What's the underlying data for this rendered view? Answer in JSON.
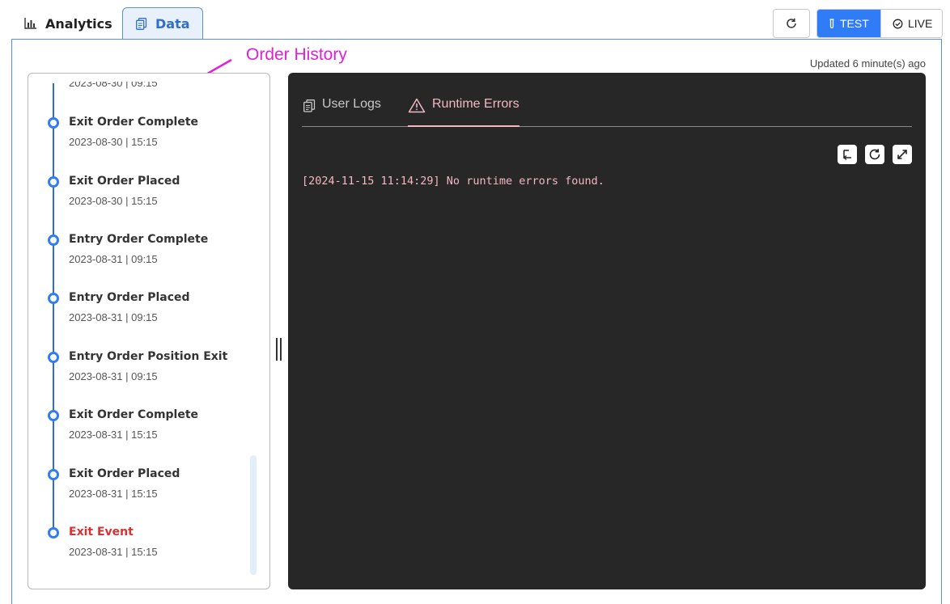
{
  "tabs": {
    "analytics_label": "Analytics",
    "data_label": "Data"
  },
  "mode": {
    "test_label": "TEST",
    "live_label": "LIVE",
    "selected": "TEST"
  },
  "annotation": {
    "text": "Order History",
    "color": "#e11fd8"
  },
  "status": {
    "updated_text": "Updated 6 minute(s) ago"
  },
  "timeline": {
    "cut_off_time": "2023-08-30 | 09:15",
    "items": [
      {
        "title": "Exit Order Complete",
        "time": "2023-08-30 | 15:15"
      },
      {
        "title": "Exit Order Placed",
        "time": "2023-08-30 | 15:15"
      },
      {
        "title": "Entry Order Complete",
        "time": "2023-08-31 | 09:15"
      },
      {
        "title": "Entry Order Placed",
        "time": "2023-08-31 | 09:15"
      },
      {
        "title": "Entry Order Position Exit",
        "time": "2023-08-31 | 09:15"
      },
      {
        "title": "Exit Order Complete",
        "time": "2023-08-31 | 15:15"
      },
      {
        "title": "Exit Order Placed",
        "time": "2023-08-31 | 15:15"
      },
      {
        "title": "Exit Event",
        "time": "2023-08-31 | 15:15",
        "is_error": true
      }
    ]
  },
  "logs": {
    "tabs": [
      {
        "label": "User Logs",
        "icon": "document-icon"
      },
      {
        "label": "Runtime Errors",
        "icon": "warning-icon",
        "active": true
      }
    ],
    "lines": [
      "[2024-11-15 11:14:29] No runtime errors found."
    ]
  },
  "colors": {
    "accent": "#2f7cf6",
    "error_text": "#d93030",
    "log_text": "#f2b8c4",
    "log_bg": "#272727"
  }
}
